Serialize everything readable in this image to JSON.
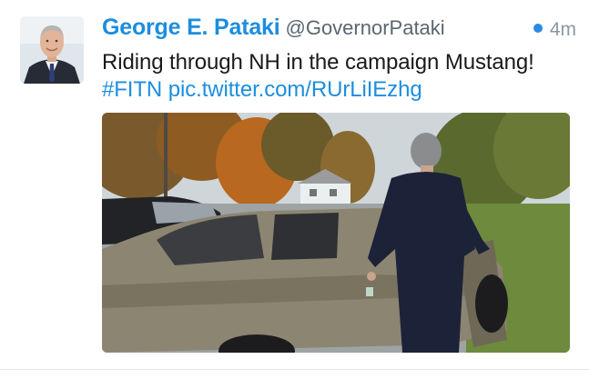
{
  "tweet": {
    "author_name": "George E. Pataki",
    "handle": "@GovernorPataki",
    "time": "4m",
    "text_part1": "Riding through NH in the campaign Mustang! ",
    "hashtag": "#FITN",
    "link": "pic.twitter.com/RUrLiIEzhg"
  },
  "colors": {
    "accent": "#1d8dde",
    "unread_dot": "#2b8be3"
  },
  "icons": {
    "unread": "unread-dot-icon"
  }
}
